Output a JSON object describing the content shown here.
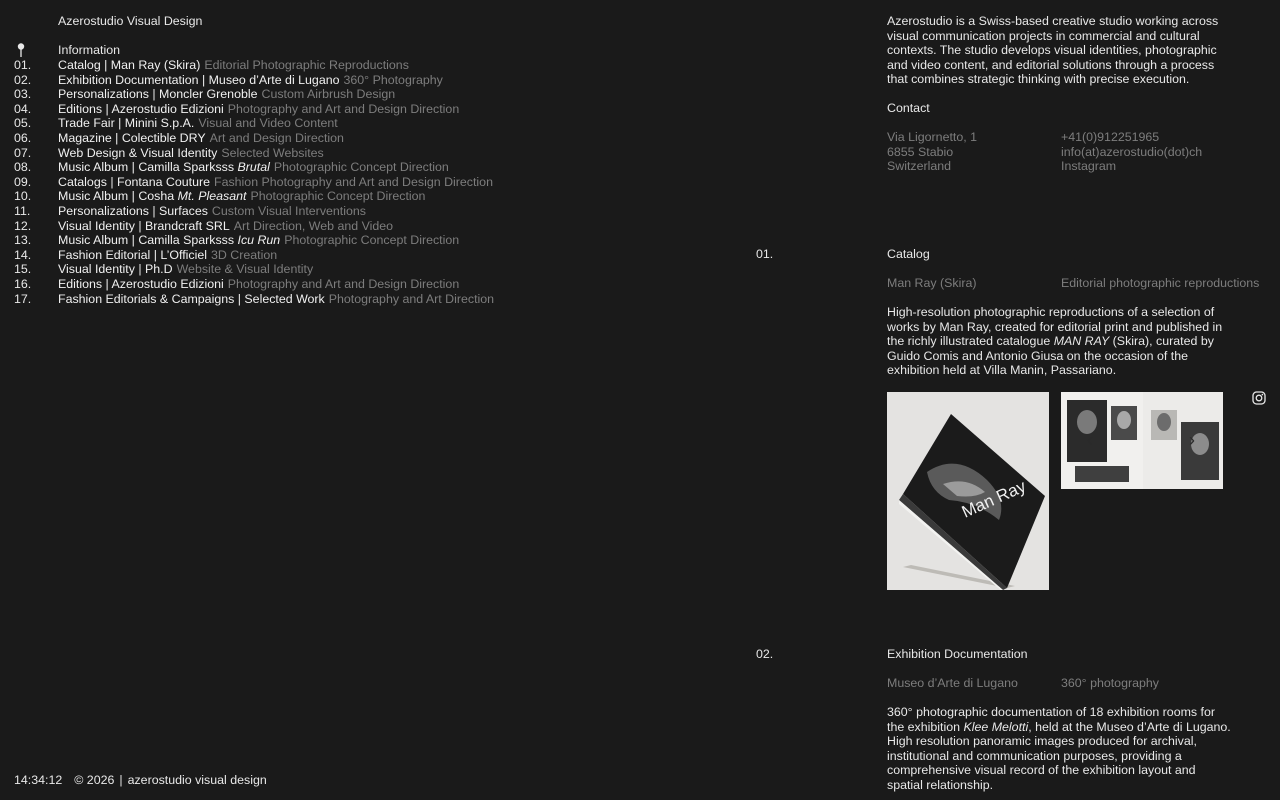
{
  "brand": "Azerostudio Visual Design",
  "nav": {
    "info_label": "Information"
  },
  "projects": [
    {
      "num": "01.",
      "title": "Catalog | Man Ray (Skira)",
      "sub": "Editorial Photographic Reproductions"
    },
    {
      "num": "02.",
      "title": "Exhibition Documentation | Museo d’Arte di Lugano",
      "sub": "360° Photography"
    },
    {
      "num": "03.",
      "title": "Personalizations | Moncler Grenoble",
      "sub": "Custom Airbrush Design"
    },
    {
      "num": "04.",
      "title": "Editions | Azerostudio Edizioni",
      "sub": "Photography and Art and Design Direction"
    },
    {
      "num": "05.",
      "title": "Trade Fair | Minini S.p.A.",
      "sub": "Visual and Video Content"
    },
    {
      "num": "06.",
      "title": "Magazine | Colectible DRY",
      "sub": "Art and Design Direction"
    },
    {
      "num": "07.",
      "title": "Web Design & Visual Identity",
      "sub": "Selected Websites"
    },
    {
      "num": "08.",
      "title_pre": "Music Album | Camilla Sparksss",
      "title_em": "Brutal",
      "sub": "Photographic Concept Direction"
    },
    {
      "num": "09.",
      "title": "Catalogs | Fontana Couture",
      "sub": "Fashion Photography and Art and Design Direction"
    },
    {
      "num": "10.",
      "title_pre": "Music Album | Cosha",
      "title_em": "Mt. Pleasant",
      "sub": "Photographic Concept Direction"
    },
    {
      "num": "11.",
      "title": "Personalizations | Surfaces",
      "sub": "Custom Visual Interventions"
    },
    {
      "num": "12.",
      "title": "Visual Identity | Brandcraft SRL",
      "sub": "Art Direction, Web and Video"
    },
    {
      "num": "13.",
      "title_pre": "Music Album | Camilla Sparksss",
      "title_em": "Icu Run",
      "sub": "Photographic Concept Direction"
    },
    {
      "num": "14.",
      "title": "Fashion Editorial | L’Officiel",
      "sub": "3D Creation"
    },
    {
      "num": "15.",
      "title": "Visual Identity | Ph.D",
      "sub": "Website & Visual Identity"
    },
    {
      "num": "16.",
      "title": "Editions | Azerostudio Edizioni",
      "sub": "Photography and Art and Design Direction"
    },
    {
      "num": "17.",
      "title": "Fashion Editorials & Campaigns | Selected Work",
      "sub": "Photography and Art Direction"
    }
  ],
  "footer": {
    "clock": "14:34:12",
    "copyright": "© 2026",
    "separator": "|",
    "name": "azerostudio visual design"
  },
  "about": "Azerostudio is a Swiss-based creative studio working across visual communication projects in commercial and cultural contexts. The studio develops visual identities, photographic and video content, and editorial solutions through a process that combines strategic thinking with precise execution.",
  "contact": {
    "label": "Contact",
    "address": [
      "Via Ligornetto, 1",
      "6855 Stabio",
      "Switzerland"
    ],
    "phone": "+41(0)912251965",
    "email": "info(at)azerostudio(dot)ch",
    "instagram": "Instagram"
  },
  "entries": [
    {
      "num": "01.",
      "title": "Catalog",
      "client": "Man Ray (Skira)",
      "type": "Editorial photographic reproductions",
      "desc_a": "High-resolution photographic reproductions of a selection of works by Man Ray, created for editorial print and published in the richly illustrated catalogue ",
      "desc_em": "MAN RAY",
      "desc_b": " (Skira), curated by Guido Comis and Antonio Giusa on the occasion of the exhibition held at Villa Manin, Passariano.",
      "book_cover_text": "Man Ray"
    },
    {
      "num": "02.",
      "title": "Exhibition Documentation",
      "client": "Museo d’Arte di Lugano",
      "type": "360° photography",
      "desc_a": "360° photographic documentation of 18 exhibition rooms for the exhibition ",
      "desc_em": "Klee Melotti",
      "desc_b": ", held at the Museo d’Arte di Lugano.",
      "desc_2": "High resolution panoramic images produced for archival, institutional and communication purposes, providing a comprehensive visual record of the exhibition layout and spatial relationship."
    }
  ],
  "carousel": {
    "prev_icon": "chevron-left-icon",
    "next_icon": "chevron-right-icon",
    "prev_glyph": "‹",
    "next_glyph": "›"
  },
  "colors": {
    "background": "#1a1a1a",
    "text": "#e8e8e8",
    "muted": "#7d7d7d"
  }
}
